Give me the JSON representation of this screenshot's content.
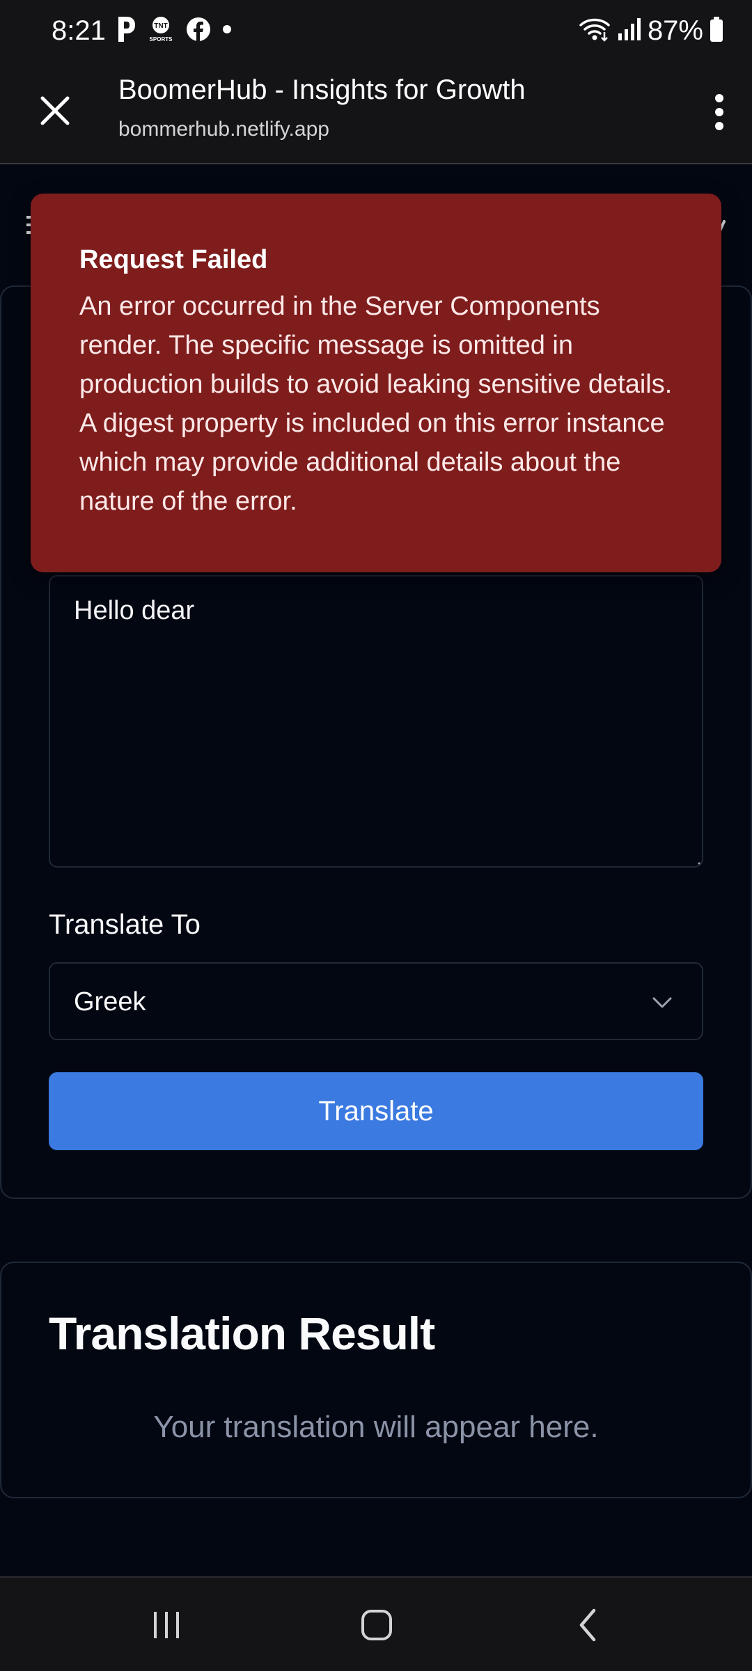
{
  "status_bar": {
    "time": "8:21",
    "notification_icons": [
      "p-icon",
      "tnt-sports-icon",
      "facebook-icon",
      "dot-icon"
    ],
    "tnt_line1": "TNT",
    "tnt_line2": "SPORTS",
    "battery_percent": "87%"
  },
  "browser": {
    "page_title": "BoomerHub - Insights for Growth",
    "url": "bommerhub.netlify.app"
  },
  "translate_form": {
    "input_text": "Hello dear",
    "target_label": "Translate To",
    "selected_language": "Greek",
    "button_label": "Translate"
  },
  "result": {
    "title": "Translation Result",
    "placeholder": "Your translation will appear here."
  },
  "toast": {
    "title": "Request Failed",
    "message": "An error occurred in the Server Components render. The specific message is omitted in production builds to avoid leaking sensitive details. A digest property is included on this error instance which may provide additional details about the nature of the error."
  },
  "colors": {
    "background": "#030712",
    "toast_bg": "#7f1d1d",
    "button_bg": "#3b7ae0",
    "placeholder_text": "#8b93a7"
  }
}
